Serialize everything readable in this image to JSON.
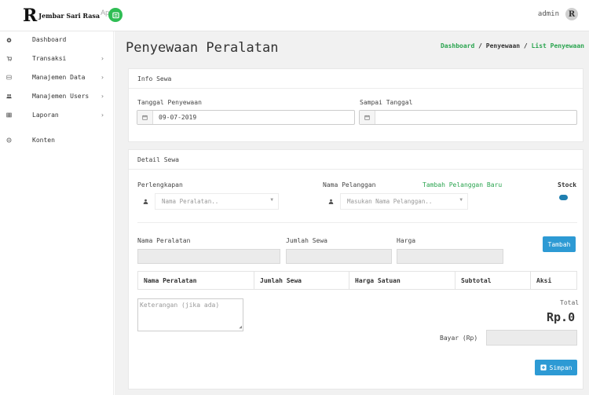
{
  "brand": {
    "logo": "R",
    "name": "Jembar Sari Rasa",
    "suffix": "App"
  },
  "user": {
    "name": "admin",
    "avatar": "R"
  },
  "sidebar": {
    "items": [
      {
        "label": "Dashboard",
        "icon": "dashboard-icon",
        "arrow": ""
      },
      {
        "label": "Transaksi",
        "icon": "cart-icon",
        "arrow": "›"
      },
      {
        "label": "Manajemen Data",
        "icon": "database-icon",
        "arrow": "›"
      },
      {
        "label": "Manajemen Users",
        "icon": "users-icon",
        "arrow": "›"
      },
      {
        "label": "Laporan",
        "icon": "table-icon",
        "arrow": "›"
      },
      {
        "label": "Konten",
        "icon": "gear-icon",
        "arrow": ""
      }
    ]
  },
  "page": {
    "title": "Penyewaan Peralatan",
    "breadcrumb": {
      "first": "Dashboard",
      "sep1": " / ",
      "second": "Penyewaan",
      "sep2": " / ",
      "current": "List Penyewaan"
    }
  },
  "info_sewa": {
    "title": "Info Sewa",
    "tanggal_label": "Tanggal Penyewaan",
    "tanggal_value": "09-07-2019",
    "sampai_label": "Sampai Tanggal",
    "sampai_value": ""
  },
  "detail_sewa": {
    "title": "Detail Sewa",
    "perlengkapan_label": "Perlengkapan",
    "perlengkapan_placeholder": "Nama Peralatan..",
    "pelanggan_label": "Nama Pelanggan",
    "pelanggan_placeholder": "Masukan Nama Pelanggan..",
    "tambah_pelanggan": "Tambah Pelanggan Baru",
    "stock_label": "Stock",
    "nama_peralatan_label": "Nama Peralatan",
    "jumlah_sewa_label": "Jumlah Sewa",
    "harga_label": "Harga",
    "tambah_button": "Tambah",
    "table_headers": [
      "Nama Peralatan",
      "Jumlah Sewa",
      "Harga Satuan",
      "Subtotal",
      "Aksi"
    ],
    "keterangan_placeholder": "Keterangan (jika ada)",
    "total_label": "Total",
    "total_value": "Rp.0",
    "bayar_label": "Bayar (Rp)",
    "simpan_button": "Simpan"
  },
  "colors": {
    "accent_green": "#2aa44f",
    "button_blue": "#2d9ad4",
    "toggle_blue": "#1f7fb0"
  }
}
